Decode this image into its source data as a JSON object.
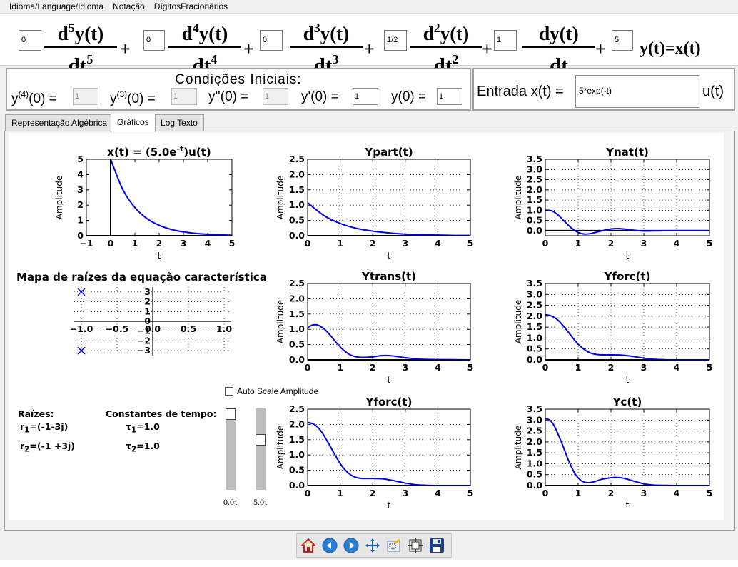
{
  "menu": [
    "Idioma/Language/Idioma",
    "Notação",
    "DígitosFracionários"
  ],
  "equation": {
    "coefficients": [
      "0",
      "0",
      "0",
      "1/2",
      "1",
      "5"
    ],
    "terms": [
      {
        "num": "d",
        "order": "5",
        "func": "y(t)",
        "den": "dt"
      },
      {
        "num": "d",
        "order": "4",
        "func": "y(t)",
        "den": "dt"
      },
      {
        "num": "d",
        "order": "3",
        "func": "y(t)",
        "den": "dt"
      },
      {
        "num": "d",
        "order": "2",
        "func": "y(t)",
        "den": "dt"
      },
      {
        "num": "d",
        "order": "",
        "func": "y(t)",
        "den": "dt"
      }
    ],
    "plus": "+",
    "rhs": "y(t)=x(t)"
  },
  "initial_conditions": {
    "title": "Condições  Iniciais:",
    "items": [
      {
        "label": "y",
        "sup": "(4)",
        "rest": "(0) =",
        "value": "1",
        "disabled": true
      },
      {
        "label": "y",
        "sup": "(3)",
        "rest": "(0) =",
        "value": "1",
        "disabled": true
      },
      {
        "label": "y''(0) =",
        "sup": "",
        "rest": "",
        "value": "1",
        "disabled": true
      },
      {
        "label": "y'(0) =",
        "sup": "",
        "rest": "",
        "value": "1",
        "disabled": false
      },
      {
        "label": "y(0) =",
        "sup": "",
        "rest": "",
        "value": "1",
        "disabled": false
      }
    ]
  },
  "input": {
    "label": "Entrada x(t) =",
    "value": "5*exp(-t)",
    "suffix": "u(t)"
  },
  "tabs": [
    {
      "label": "Representação Algébrica",
      "active": false
    },
    {
      "label": "Gráficos",
      "active": true
    },
    {
      "label": "Log Texto",
      "active": false
    }
  ],
  "roots_map": {
    "title": "Mapa de raízes da equação característica"
  },
  "roots": {
    "header": "Raízes:",
    "items": [
      {
        "sym": "r",
        "sub": "1",
        "val": "=(-1-3j)"
      },
      {
        "sym": "r",
        "sub": "2",
        "val": "=(-1 +3j)"
      }
    ]
  },
  "time_constants": {
    "header": "Constantes de tempo:",
    "items": [
      {
        "sym": "τ",
        "sub": "1",
        "val": "=1.0"
      },
      {
        "sym": "τ",
        "sub": "2",
        "val": "=1.0"
      }
    ]
  },
  "auto_scale": {
    "label": "Auto Scale Amplitude",
    "checked": false
  },
  "sliders": [
    {
      "label": "0.0τ",
      "value": 0.0
    },
    {
      "label": "5.0τ",
      "value": 5.0
    }
  ],
  "toolbar": [
    "home-icon",
    "back-arrow-icon",
    "forward-arrow-icon",
    "pan-icon",
    "zoom-icon",
    "configure-subplots-icon",
    "save-icon"
  ],
  "colors": {
    "curve": "#0000ee",
    "root_marker": "#0000ee"
  },
  "chart_data": [
    {
      "id": "x",
      "type": "line",
      "title": "x(t) = (5.0e",
      "title_sup": "-t",
      "title_end": ")u(t)",
      "xlabel": "t",
      "ylabel": "Amplitude",
      "xlim": [
        -1,
        5
      ],
      "ylim": [
        0,
        5
      ],
      "xticks": [
        -1,
        0,
        1,
        2,
        3,
        4,
        5
      ],
      "xtick_labels": [
        "−1",
        "0",
        "1",
        "2",
        "3",
        "4",
        "5"
      ],
      "yticks": [
        0,
        1,
        2,
        3,
        4,
        5
      ],
      "ytick_labels": [
        "0",
        "1",
        "2",
        "3",
        "4",
        "5"
      ],
      "grid": false,
      "x": [
        0,
        0.5,
        1,
        1.5,
        2,
        2.5,
        3,
        3.5,
        4,
        4.5,
        5
      ],
      "y": [
        5.0,
        3.03,
        1.84,
        1.12,
        0.68,
        0.41,
        0.25,
        0.15,
        0.09,
        0.06,
        0.03
      ]
    },
    {
      "id": "ypart",
      "type": "line",
      "title": "Ypart(t)",
      "xlabel": "t",
      "ylabel": "Amplitude",
      "xlim": [
        0,
        5
      ],
      "ylim": [
        0,
        2.5
      ],
      "xticks": [
        0,
        1,
        2,
        3,
        4,
        5
      ],
      "xtick_labels": [
        "0",
        "1",
        "2",
        "3",
        "4",
        "5"
      ],
      "yticks": [
        0,
        0.5,
        1.0,
        1.5,
        2.0,
        2.5
      ],
      "ytick_labels": [
        "0.0",
        "0.5",
        "1.0",
        "1.5",
        "2.0",
        "2.5"
      ],
      "grid": true,
      "x": [
        0,
        0.5,
        1,
        1.5,
        2,
        2.5,
        3,
        3.5,
        4,
        4.5,
        5
      ],
      "y": [
        1.08,
        0.66,
        0.4,
        0.24,
        0.15,
        0.09,
        0.05,
        0.03,
        0.02,
        0.01,
        0.01
      ]
    },
    {
      "id": "ynat",
      "type": "line",
      "title": "Ynat(t)",
      "xlabel": "t",
      "ylabel": "Amplitude",
      "xlim": [
        0,
        5
      ],
      "ylim": [
        -0.25,
        3.5
      ],
      "xticks": [
        0,
        1,
        2,
        3,
        4,
        5
      ],
      "xtick_labels": [
        "0",
        "1",
        "2",
        "3",
        "4",
        "5"
      ],
      "yticks": [
        0,
        0.5,
        1.0,
        1.5,
        2.0,
        2.5,
        3.0,
        3.5
      ],
      "ytick_labels": [
        "0.0",
        "0.5",
        "1.0",
        "1.5",
        "2.0",
        "2.5",
        "3.0",
        "3.5"
      ],
      "grid": true,
      "x": [
        0,
        0.2,
        0.4,
        0.6,
        0.8,
        1.0,
        1.2,
        1.4,
        1.6,
        1.8,
        2.0,
        2.2,
        2.4,
        2.6,
        2.8,
        3.0,
        3.5,
        4.0,
        4.5,
        5.0
      ],
      "y": [
        1.0,
        0.97,
        0.75,
        0.43,
        0.12,
        -0.09,
        -0.17,
        -0.14,
        -0.06,
        0.02,
        0.08,
        0.1,
        0.08,
        0.04,
        0.0,
        -0.02,
        -0.01,
        0.0,
        0.0,
        0.0
      ]
    },
    {
      "id": "ytrans",
      "type": "line",
      "title": "Ytrans(t)",
      "xlabel": "t",
      "ylabel": "Amplitude",
      "xlim": [
        0,
        5
      ],
      "ylim": [
        0,
        2.5
      ],
      "xticks": [
        0,
        1,
        2,
        3,
        4,
        5
      ],
      "xtick_labels": [
        "0",
        "1",
        "2",
        "3",
        "4",
        "5"
      ],
      "yticks": [
        0,
        0.5,
        1.0,
        1.5,
        2.0,
        2.5
      ],
      "ytick_labels": [
        "0.0",
        "0.5",
        "1.0",
        "1.5",
        "2.0",
        "2.5"
      ],
      "grid": true,
      "x": [
        0,
        0.15,
        0.3,
        0.5,
        0.7,
        0.9,
        1.1,
        1.3,
        1.5,
        1.7,
        2.0,
        2.3,
        2.6,
        3.0,
        3.5,
        4.0,
        5.0
      ],
      "y": [
        1.05,
        1.14,
        1.14,
        1.02,
        0.8,
        0.54,
        0.32,
        0.17,
        0.1,
        0.08,
        0.1,
        0.14,
        0.13,
        0.07,
        0.02,
        0.01,
        0.0
      ]
    },
    {
      "id": "yforc",
      "type": "line",
      "title": "Yforc(t)",
      "xlabel": "t",
      "ylabel": "Amplitude",
      "xlim": [
        0,
        5
      ],
      "ylim": [
        0,
        3.5
      ],
      "xticks": [
        0,
        1,
        2,
        3,
        4,
        5
      ],
      "xtick_labels": [
        "0",
        "1",
        "2",
        "3",
        "4",
        "5"
      ],
      "yticks": [
        0,
        0.5,
        1.0,
        1.5,
        2.0,
        2.5,
        3.0,
        3.5
      ],
      "ytick_labels": [
        "0.0",
        "0.5",
        "1.0",
        "1.5",
        "2.0",
        "2.5",
        "3.0",
        "3.5"
      ],
      "grid": true,
      "x": [
        0,
        0.2,
        0.4,
        0.6,
        0.8,
        1.0,
        1.2,
        1.4,
        1.6,
        1.8,
        2.0,
        2.3,
        2.6,
        3.0,
        3.3,
        3.6,
        4.0,
        4.5,
        5.0
      ],
      "y": [
        2.07,
        2.0,
        1.8,
        1.46,
        1.08,
        0.72,
        0.46,
        0.3,
        0.24,
        0.23,
        0.23,
        0.22,
        0.17,
        0.08,
        0.03,
        0.01,
        0.0,
        0.0,
        0.0
      ]
    },
    {
      "id": "yforc2",
      "type": "line",
      "title": "Yforc(t)",
      "xlabel": "t",
      "ylabel": "Amplitude",
      "xlim": [
        0,
        5
      ],
      "ylim": [
        0,
        2.5
      ],
      "xticks": [
        0,
        1,
        2,
        3,
        4,
        5
      ],
      "xtick_labels": [
        "0",
        "1",
        "2",
        "3",
        "4",
        "5"
      ],
      "yticks": [
        0,
        0.5,
        1.0,
        1.5,
        2.0,
        2.5
      ],
      "ytick_labels": [
        "0.0",
        "0.5",
        "1.0",
        "1.5",
        "2.0",
        "2.5"
      ],
      "grid": true,
      "x": [
        0,
        0.2,
        0.4,
        0.6,
        0.8,
        1.0,
        1.2,
        1.4,
        1.6,
        1.8,
        2.0,
        2.3,
        2.6,
        3.0,
        3.3,
        3.6,
        4.0,
        4.5,
        5.0
      ],
      "y": [
        2.07,
        2.0,
        1.8,
        1.46,
        1.08,
        0.72,
        0.46,
        0.3,
        0.24,
        0.23,
        0.23,
        0.22,
        0.17,
        0.08,
        0.03,
        0.01,
        0.0,
        0.0,
        0.0
      ]
    },
    {
      "id": "yc",
      "type": "line",
      "title": "Yc(t)",
      "xlabel": "t",
      "ylabel": "Amplitude",
      "xlim": [
        0,
        5
      ],
      "ylim": [
        0,
        3.5
      ],
      "xticks": [
        0,
        1,
        2,
        3,
        4,
        5
      ],
      "xtick_labels": [
        "0",
        "1",
        "2",
        "3",
        "4",
        "5"
      ],
      "yticks": [
        0,
        0.5,
        1.0,
        1.5,
        2.0,
        2.5,
        3.0,
        3.5
      ],
      "ytick_labels": [
        "0.0",
        "0.5",
        "1.0",
        "1.5",
        "2.0",
        "2.5",
        "3.0",
        "3.5"
      ],
      "grid": true,
      "x": [
        0,
        0.15,
        0.3,
        0.5,
        0.7,
        0.9,
        1.1,
        1.3,
        1.5,
        1.7,
        2.0,
        2.2,
        2.4,
        2.7,
        3.0,
        3.3,
        3.6,
        4.0,
        5.0
      ],
      "y": [
        3.07,
        2.98,
        2.65,
        1.95,
        1.18,
        0.55,
        0.22,
        0.13,
        0.18,
        0.28,
        0.36,
        0.37,
        0.33,
        0.2,
        0.08,
        0.02,
        0.01,
        0.0,
        0.0
      ]
    },
    {
      "id": "roots",
      "type": "scatter",
      "title": "Mapa de raízes da equação característica",
      "xlim": [
        -1.1,
        1.1
      ],
      "ylim": [
        -3.5,
        3.5
      ],
      "xticks": [
        -1.0,
        -0.5,
        0.0,
        0.5,
        1.0
      ],
      "xtick_labels": [
        "−1.0",
        "−0.5",
        "0.0",
        "0.5",
        "1.0"
      ],
      "yticks": [
        -3,
        -2,
        -1,
        0,
        1,
        2,
        3
      ],
      "ytick_labels": [
        "−3",
        "−2",
        "−1",
        "0",
        "1",
        "2",
        "3"
      ],
      "grid": true,
      "points": [
        {
          "x": -1,
          "y": 3
        },
        {
          "x": -1,
          "y": -3
        }
      ]
    }
  ]
}
